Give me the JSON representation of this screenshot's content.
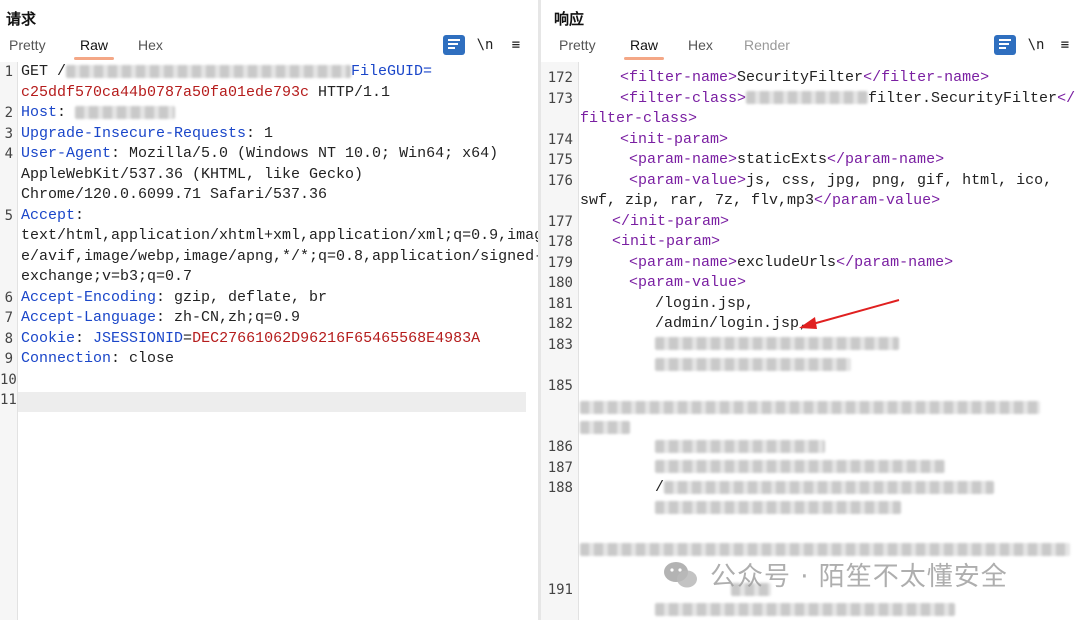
{
  "request": {
    "title": "请求",
    "tabs": [
      {
        "label": "Pretty",
        "active": false
      },
      {
        "label": "Raw",
        "active": true
      },
      {
        "label": "Hex",
        "active": false
      }
    ],
    "toolbar": {
      "newline_label": "\\n",
      "menu_label": "≡"
    },
    "lines": [
      {
        "num": "1",
        "a": "GET /",
        "b": "FileGUID="
      },
      {
        "num": "",
        "a": "c25ddf570ca44b0787a50fa01ede793c",
        "b": " HTTP/1.1"
      },
      {
        "num": "2",
        "a": "Host",
        "b": ": "
      },
      {
        "num": "3",
        "a": "Upgrade-Insecure-Requests",
        "b": ": 1"
      },
      {
        "num": "4",
        "a": "User-Agent",
        "b": ": Mozilla/5.0 (Windows NT 10.0; Win64; x64)"
      },
      {
        "num": "",
        "a": "AppleWebKit/537.36 (KHTML, like Gecko)"
      },
      {
        "num": "",
        "a": "Chrome/120.0.6099.71 Safari/537.36"
      },
      {
        "num": "5",
        "a": "Accept",
        "b": ":"
      },
      {
        "num": "",
        "a": "text/html,application/xhtml+xml,application/xml;q=0.9,imag"
      },
      {
        "num": "",
        "a": "e/avif,image/webp,image/apng,*/*;q=0.8,application/signed-"
      },
      {
        "num": "",
        "a": "exchange;v=b3;q=0.7"
      },
      {
        "num": "6",
        "a": "Accept-Encoding",
        "b": ": gzip, deflate, br"
      },
      {
        "num": "7",
        "a": "Accept-Language",
        "b": ": zh-CN,zh;q=0.9"
      },
      {
        "num": "8",
        "a": "Cookie",
        "b": ": ",
        "c": "JSESSIONID",
        "d": "=",
        "e": "DEC27661062D96216F65465568E4983A"
      },
      {
        "num": "9",
        "a": "Connection",
        "b": ": close"
      },
      {
        "num": "10",
        "a": ""
      },
      {
        "num": "11",
        "a": ""
      }
    ]
  },
  "response": {
    "title": "响应",
    "tabs": [
      {
        "label": "Pretty",
        "active": false
      },
      {
        "label": "Raw",
        "active": true
      },
      {
        "label": "Hex",
        "active": false
      },
      {
        "label": "Render",
        "active": false
      }
    ],
    "toolbar": {
      "newline_label": "\\n",
      "menu_label": "≡"
    },
    "lines": [
      {
        "num": "172",
        "a": "<filter-name>",
        "b": "SecurityFilter",
        "c": "</filter-name>"
      },
      {
        "num": "173",
        "a": "<filter-class>",
        "b": "filter.SecurityFilter",
        "c": "</"
      },
      {
        "num": "",
        "a": "filter-class>"
      },
      {
        "num": "174",
        "a": "<init-param>"
      },
      {
        "num": "175",
        "a": "<param-name>",
        "b": "staticExts",
        "c": "</param-name>"
      },
      {
        "num": "176",
        "a": "<param-value>",
        "b": "js, css, jpg, png, gif, html, ico,"
      },
      {
        "num": "",
        "a": "swf, zip, rar, 7z, flv,mp3",
        "b": "</param-value>"
      },
      {
        "num": "177",
        "a": "</init-param>"
      },
      {
        "num": "178",
        "a": "<init-param>"
      },
      {
        "num": "179",
        "a": "<param-name>",
        "b": "excludeUrls",
        "c": "</param-name>"
      },
      {
        "num": "180",
        "a": "<param-value>"
      },
      {
        "num": "181",
        "a": "/login.jsp,"
      },
      {
        "num": "182",
        "a": "/admin/login.jsp,"
      },
      {
        "num": "183",
        "a": ""
      },
      {
        "num": "185",
        "a": ""
      },
      {
        "num": "186",
        "a": ""
      },
      {
        "num": "187",
        "a": ""
      },
      {
        "num": "188",
        "a": "/"
      },
      {
        "num": "191",
        "a": ""
      }
    ]
  },
  "watermark": {
    "text": "公众号 · 陌笙不太懂安全"
  },
  "colors": {
    "key": "#1a46c9",
    "value": "#b51c1c",
    "tag": "#7a1fa2",
    "accent": "#2f6fbf",
    "arrow": "#e02020"
  }
}
